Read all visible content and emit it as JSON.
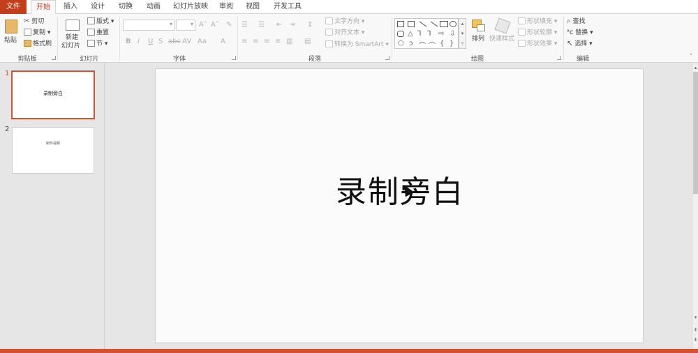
{
  "tabs": [
    "文件",
    "开始",
    "插入",
    "设计",
    "切换",
    "动画",
    "幻灯片放映",
    "审阅",
    "视图",
    "开发工具"
  ],
  "ribbon": {
    "clipboard": {
      "paste": "粘贴",
      "cut": "剪切",
      "copy": "复制",
      "format_painter": "格式刷",
      "label": "剪贴板"
    },
    "slides": {
      "new_slide_1": "新建",
      "new_slide_2": "幻灯片",
      "layout": "版式",
      "reset": "重置",
      "section": "节",
      "label": "幻灯片"
    },
    "font": {
      "label": "字体"
    },
    "paragraph": {
      "text_direction": "文字方向",
      "align_text": "对齐文本",
      "smartart": "转换为 SmartArt",
      "label": "段落"
    },
    "drawing": {
      "arrange": "排列",
      "quick_styles": "快速样式",
      "shape_fill": "形状填充",
      "shape_outline": "形状轮廓",
      "shape_effects": "形状效果",
      "label": "绘图"
    },
    "editing": {
      "find": "查找",
      "replace": "替换",
      "select": "选择",
      "label": "编辑"
    }
  },
  "thumbnails": [
    {
      "number": "1",
      "text": "录制旁白",
      "selected": true
    },
    {
      "number": "2",
      "text": "制作视频",
      "selected": false
    }
  ],
  "slide": {
    "title": "录制旁白"
  },
  "colors": {
    "accent": "#c43e1c",
    "selection": "#d35230"
  }
}
